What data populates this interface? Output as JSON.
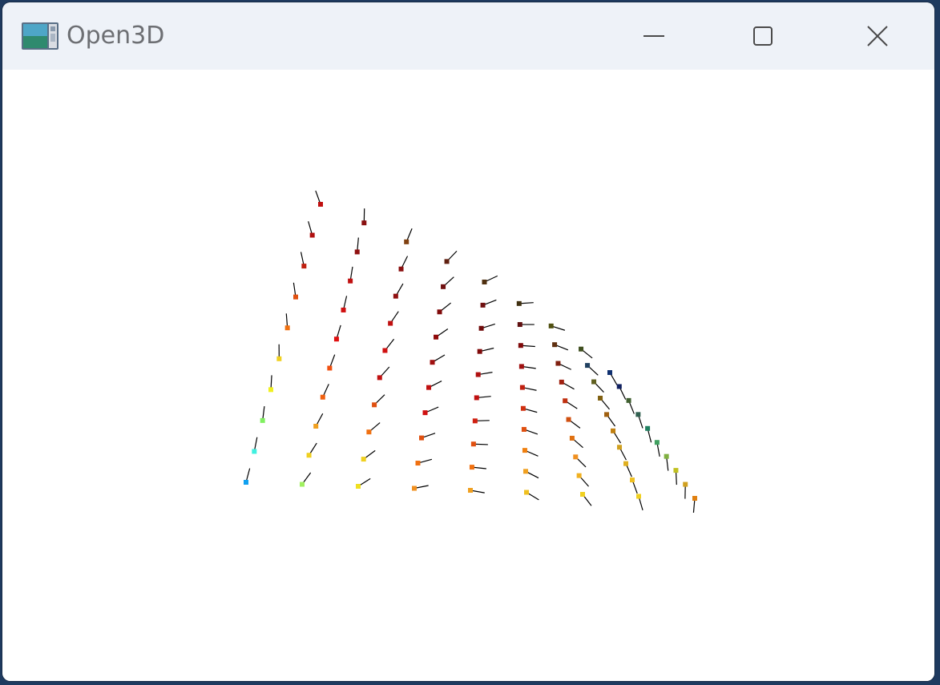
{
  "window": {
    "title": "Open3D",
    "icon": "open3d-app-icon",
    "controls": {
      "minimize_icon": "minimize-icon",
      "maximize_icon": "maximize-icon",
      "close_icon": "close-icon"
    }
  },
  "scene": {
    "background": "#ffffff",
    "normal_color": "#000000",
    "points": [
      [
        "#c01010"
      ],
      [
        "#b01010"
      ],
      [
        "#c02010"
      ],
      [
        "#e05010"
      ],
      [
        "#f07010"
      ],
      [
        "#f0d020"
      ],
      [
        "#f0f020"
      ],
      [
        "#80f060"
      ],
      [
        "#40f0e0"
      ],
      [
        "#10a0f0"
      ],
      [
        "#8a1010"
      ],
      [
        "#901010"
      ],
      [
        "#c01010"
      ],
      [
        "#d01010"
      ],
      [
        "#e01010"
      ],
      [
        "#f05010"
      ],
      [
        "#f06010"
      ],
      [
        "#f0a020"
      ],
      [
        "#f0d020"
      ],
      [
        "#a0f060"
      ],
      [
        "#804010"
      ],
      [
        "#8a1010"
      ],
      [
        "#901010"
      ],
      [
        "#c01010"
      ],
      [
        "#d01010"
      ],
      [
        "#c01010"
      ],
      [
        "#e05010"
      ],
      [
        "#f07010"
      ],
      [
        "#f0d020"
      ],
      [
        "#f0e020"
      ],
      [
        "#602010"
      ],
      [
        "#701010"
      ],
      [
        "#800a0a"
      ],
      [
        "#900a0a"
      ],
      [
        "#a01010"
      ],
      [
        "#c01010"
      ],
      [
        "#d01010"
      ],
      [
        "#e05010"
      ],
      [
        "#f07010"
      ],
      [
        "#f09020"
      ],
      [
        "#503010"
      ],
      [
        "#701010"
      ],
      [
        "#700a0a"
      ],
      [
        "#800a0a"
      ],
      [
        "#b01010"
      ],
      [
        "#c01010"
      ],
      [
        "#d02010"
      ],
      [
        "#e05010"
      ],
      [
        "#f07010"
      ],
      [
        "#f0a020"
      ],
      [
        "#403010"
      ],
      [
        "#601010"
      ],
      [
        "#800a0a"
      ],
      [
        "#a01010"
      ],
      [
        "#c02010"
      ],
      [
        "#d03010"
      ],
      [
        "#e05010"
      ],
      [
        "#f08010"
      ],
      [
        "#f0a020"
      ],
      [
        "#f0c020"
      ],
      [
        "#505010"
      ],
      [
        "#603010"
      ],
      [
        "#802010"
      ],
      [
        "#a02010"
      ],
      [
        "#c03010"
      ],
      [
        "#d05010"
      ],
      [
        "#e07010"
      ],
      [
        "#f09020"
      ],
      [
        "#f0b020"
      ],
      [
        "#f0d020"
      ],
      [
        "#405020"
      ],
      [
        "#204060"
      ],
      [
        "#606020"
      ],
      [
        "#806010"
      ],
      [
        "#a06010"
      ],
      [
        "#c08010"
      ],
      [
        "#d0a020"
      ],
      [
        "#e0b020"
      ],
      [
        "#f0c020"
      ],
      [
        "#f0d020"
      ],
      [
        "#103070"
      ],
      [
        "#102060"
      ],
      [
        "#406030"
      ],
      [
        "#306050"
      ],
      [
        "#208060"
      ],
      [
        "#40a060"
      ],
      [
        "#80b040"
      ],
      [
        "#c0c020"
      ],
      [
        "#d0a020"
      ],
      [
        "#e08010"
      ],
      [
        "#c01010"
      ],
      [
        "#d02010"
      ],
      [
        "#c03010"
      ]
    ]
  }
}
